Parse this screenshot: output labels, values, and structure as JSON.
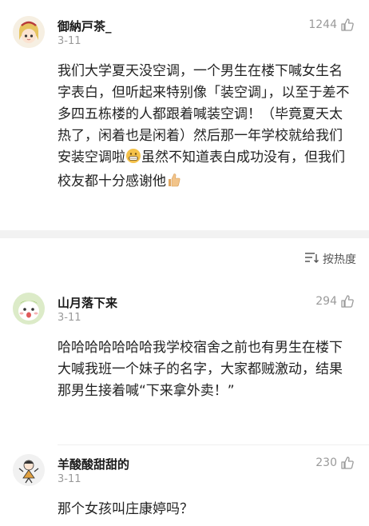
{
  "comments": [
    {
      "username": "御納戸茶_",
      "date": "3-11",
      "likes": "1244",
      "text_a": "我们大学夏天没空调，一个男生在楼下喊女生名字表白，但听起来特别像「装空调」，以至于差不多四五栋楼的人都跟着喊装空调！（毕竟夏天太热了，闲着也是闲着）然后那一年学校就给我们安装空调啦",
      "text_b": "虽然不知道表白成功没有，但我们校友都十分感谢他"
    },
    {
      "username": "山月落下来",
      "date": "3-11",
      "likes": "294",
      "text": "哈哈哈哈哈哈哈我学校宿舍之前也有男生在楼下大喊我班一个妹子的名字，大家都贼激动，结果那男生接着喊“下来拿外卖！”"
    },
    {
      "username": "羊酸酸甜甜的",
      "date": "3-11",
      "likes": "230",
      "text": "那个女孩叫庄康婷吗？"
    }
  ],
  "sort": {
    "label": "按热度"
  },
  "icons": {
    "like": "thumbs-up-icon",
    "sort": "sort-icon",
    "grin": "grinning-emoji",
    "thumb": "thumbs-up-emoji"
  },
  "colors": {
    "muted": "#9a9a9a",
    "separator": "#f2f2f2",
    "emoji": "#f5c24a"
  }
}
